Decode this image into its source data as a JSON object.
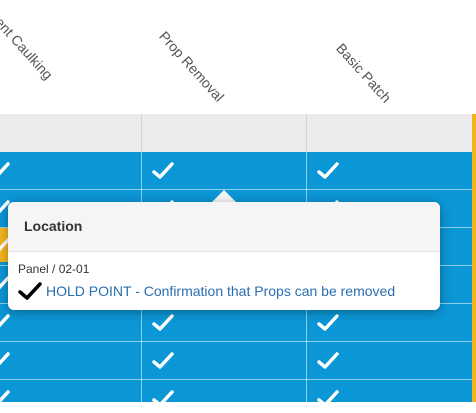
{
  "columns": [
    {
      "label": "ent Caulking"
    },
    {
      "label": "Prop Removal"
    },
    {
      "label": "Basic Patch"
    }
  ],
  "colors": {
    "grid_blue": "#0b96d6",
    "accent_yellow": "#f2b51c",
    "link_blue": "#2a6fb0"
  },
  "popover": {
    "title": "Location",
    "panel_ref": "Panel / 02-01",
    "item_icon": "checkmark-icon",
    "item_text": "HOLD POINT - Confirmation that Props can be removed"
  }
}
